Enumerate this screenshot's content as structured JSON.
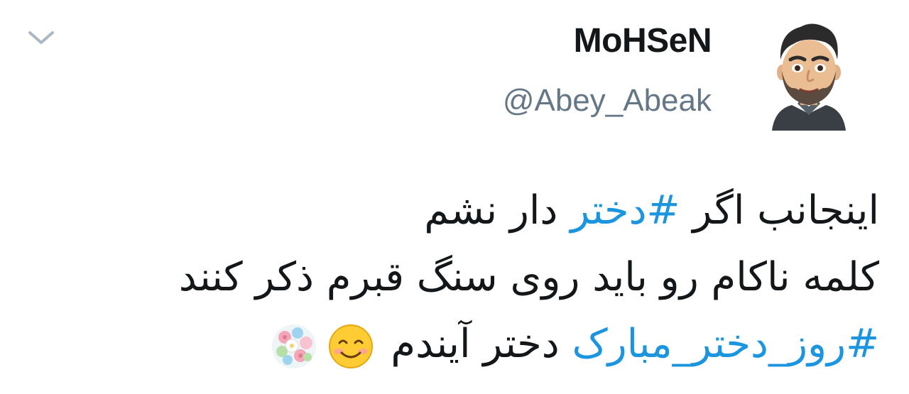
{
  "header": {
    "chevron_icon": "chevron-down-icon",
    "avatar_icon": "bitmoji-avatar"
  },
  "user": {
    "display_name": "MoHSeN",
    "handle": "@Abey_Abeak"
  },
  "tweet": {
    "line1_text_a": "اینجانب اگر ",
    "line1_hashtag": "#دختر",
    "line1_text_b": " دار نشم",
    "line2_text": "کلمه ناکام رو باید روی سنگ قبرم ذکر کنند",
    "line3_hashtag": "#روز_دختر_مبارک",
    "line3_text": " دختر آیندم ",
    "emojis": [
      "smiling-face-icon",
      "bouquet-icon"
    ]
  },
  "colors": {
    "hashtag": "#1b95e0",
    "text": "#14171a",
    "secondary": "#657786"
  }
}
